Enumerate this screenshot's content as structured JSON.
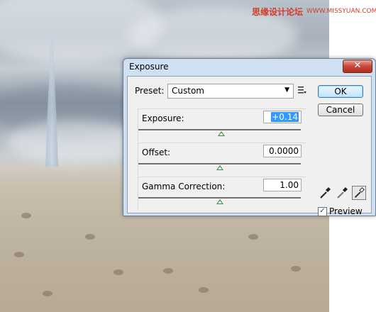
{
  "watermark": {
    "text": "思缘设计论坛",
    "site": "WWW.MISSYUAN.COM"
  },
  "dialog": {
    "title": "Exposure",
    "close_label": "✕",
    "preset": {
      "label": "Preset:",
      "value": "Custom"
    },
    "exposure": {
      "label": "Exposure:",
      "value": "+0.14",
      "slider_fraction": 0.51
    },
    "offset": {
      "label": "Offset:",
      "value": "0.0000",
      "slider_fraction": 0.5
    },
    "gamma": {
      "label": "Gamma Correction:",
      "value": "1.00",
      "slider_fraction": 0.5
    },
    "ok_label": "OK",
    "cancel_label": "Cancel",
    "preview": {
      "label": "Preview",
      "checked": true
    }
  }
}
